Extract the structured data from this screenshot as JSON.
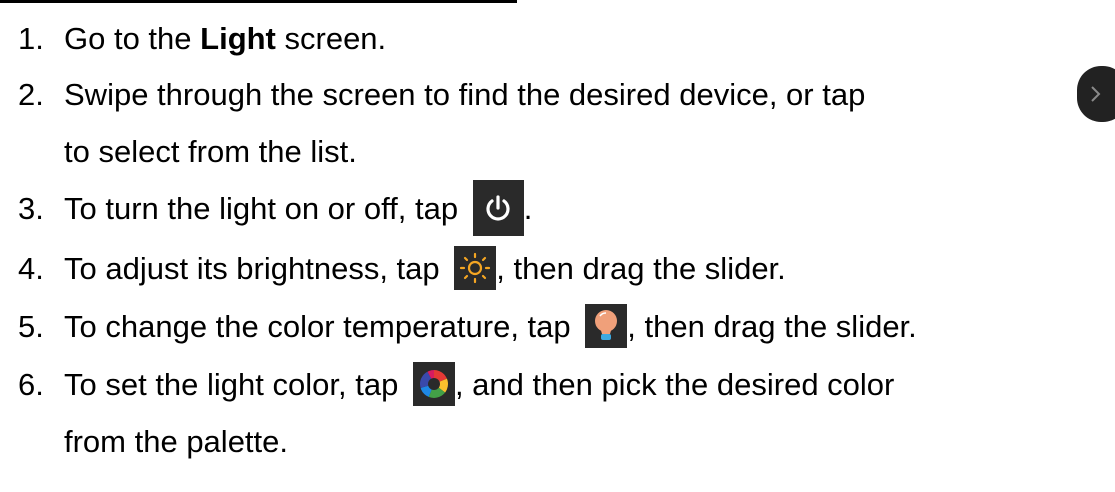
{
  "steps": [
    {
      "num": "1.",
      "before": "Go to the ",
      "bold": "Light",
      "after": " screen."
    },
    {
      "num": "2.",
      "text": "Swipe through the screen to find the desired device, or tap",
      "continuation": "to select from the list.",
      "icon": "chevron-right-icon"
    },
    {
      "num": "3.",
      "before": "To turn the light on or off, tap ",
      "after": ".",
      "icon": "power-icon"
    },
    {
      "num": "4.",
      "before": "To adjust its brightness, tap ",
      "after": ", then drag the slider.",
      "icon": "brightness-icon"
    },
    {
      "num": "5.",
      "before": "To change the color temperature, tap ",
      "after": ", then drag the slider.",
      "icon": "bulb-icon"
    },
    {
      "num": "6.",
      "before": "To set the light color, tap ",
      "after": ", and then pick the desired color",
      "continuation": "from the palette.",
      "icon": "color-wheel-icon"
    }
  ],
  "colors": {
    "icon_background": "#2a2a2a",
    "bulb": "#f0a07a",
    "bulb_base": "#3da9e0",
    "sun": "#f5a623"
  }
}
